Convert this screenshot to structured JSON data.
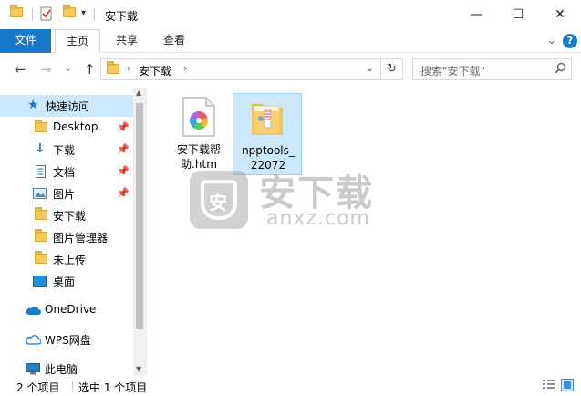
{
  "window": {
    "title": "安下载",
    "minimize_glyph": "—",
    "maximize_glyph": "☐",
    "close_glyph": "✕"
  },
  "ribbon": {
    "tabs": [
      {
        "label": "文件"
      },
      {
        "label": "主页"
      },
      {
        "label": "共享"
      },
      {
        "label": "查看"
      }
    ],
    "expand_glyph": "⌄",
    "help_glyph": "?"
  },
  "address": {
    "back_glyph": "←",
    "forward_glyph": "→",
    "dropdown_glyph": "⌄",
    "up_glyph": "↑",
    "path_segments": [
      "安下载"
    ],
    "refresh_glyph": "↻",
    "search_placeholder": "搜索\"安下载\""
  },
  "nav": {
    "items": [
      {
        "label": "快速访问",
        "icon": "star-icon"
      },
      {
        "label": "Desktop",
        "icon": "folder-icon",
        "pinned": true
      },
      {
        "label": "下载",
        "icon": "download-icon",
        "pinned": true
      },
      {
        "label": "文档",
        "icon": "document-icon",
        "pinned": true
      },
      {
        "label": "图片",
        "icon": "picture-icon",
        "pinned": true
      },
      {
        "label": "安下载",
        "icon": "folder-icon"
      },
      {
        "label": "图片管理器",
        "icon": "folder-icon"
      },
      {
        "label": "未上传",
        "icon": "folder-icon"
      },
      {
        "label": "桌面",
        "icon": "desktop-icon"
      },
      {
        "label": "OneDrive",
        "icon": "onedrive-icon"
      },
      {
        "label": "WPS网盘",
        "icon": "cloud-icon"
      },
      {
        "label": "此电脑",
        "icon": "computer-icon"
      }
    ]
  },
  "files": [
    {
      "name_line1": "安下载帮",
      "name_line2": "助.htm",
      "icon": "html-file-icon"
    },
    {
      "name_line1": "npptools_",
      "name_line2": "22072",
      "icon": "zip-folder-icon",
      "selected": true
    }
  ],
  "watermark": {
    "main": "安下载",
    "sub": "anxz.com",
    "badge": "安"
  },
  "status": {
    "item_count": "2 个项目",
    "selection": "选中 1 个项目"
  },
  "colors": {
    "accent": "#1979ca",
    "selection_bg": "#cce8ff",
    "selection_border": "#99d1ff"
  }
}
